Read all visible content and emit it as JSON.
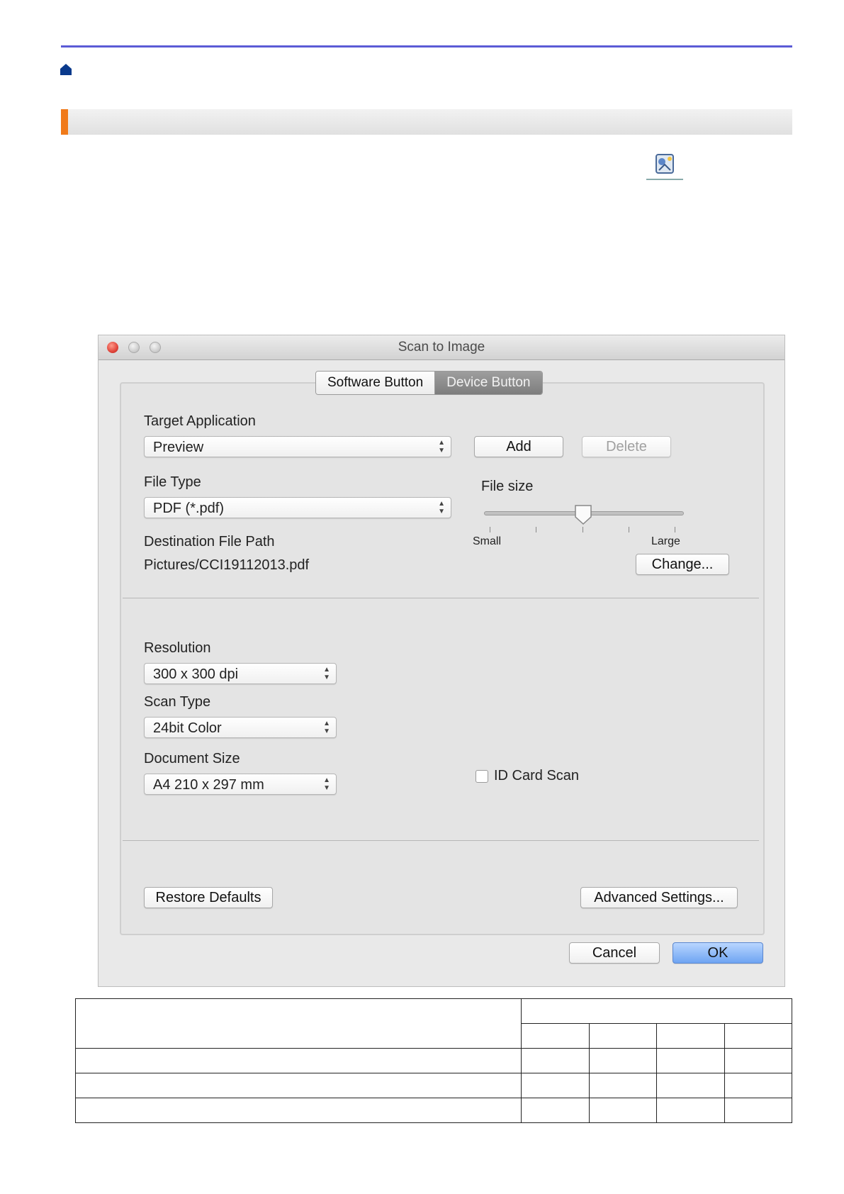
{
  "dialog": {
    "title": "Scan to Image",
    "tabs": [
      {
        "label": "Software Button",
        "selected": true
      },
      {
        "label": "Device Button",
        "selected": false
      }
    ],
    "target_application": {
      "label": "Target Application",
      "value": "Preview"
    },
    "add_label": "Add",
    "delete_label": "Delete",
    "file_type": {
      "label": "File Type",
      "value": "PDF (*.pdf)"
    },
    "file_size": {
      "label": "File size",
      "min_label": "Small",
      "max_label": "Large",
      "level_fraction": 0.5
    },
    "destination": {
      "label": "Destination File Path",
      "value": "Pictures/CCI19112013.pdf"
    },
    "change_label": "Change...",
    "resolution": {
      "label": "Resolution",
      "value": "300 x 300 dpi"
    },
    "scan_type": {
      "label": "Scan Type",
      "value": "24bit Color"
    },
    "document_size": {
      "label": "Document Size",
      "value": "A4 210 x 297 mm"
    },
    "id_card_scan": {
      "label": "ID Card Scan",
      "checked": false
    },
    "restore_label": "Restore Defaults",
    "advanced_label": "Advanced Settings...",
    "cancel_label": "Cancel",
    "ok_label": "OK"
  },
  "colors": {
    "accent_line": "#5b5bd6",
    "section_marker": "#f07a1a",
    "home_icon": "#0a3a8c"
  }
}
